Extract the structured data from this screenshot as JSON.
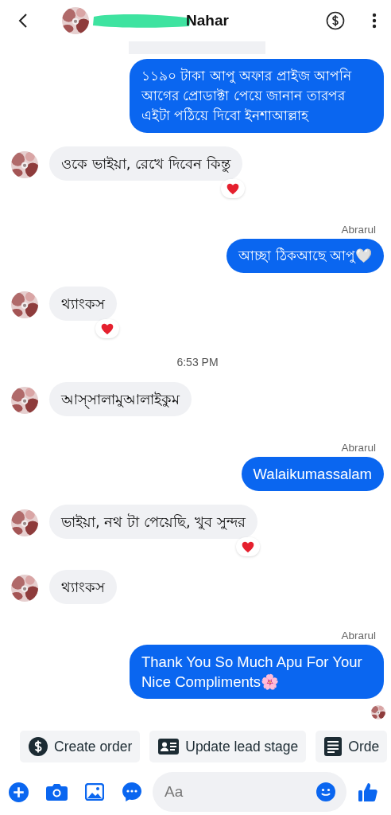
{
  "header": {
    "contact_name": "Nahar",
    "redacted": true
  },
  "messages": [
    {
      "kind": "partial"
    },
    {
      "kind": "outgoing",
      "text": "১১৯০ টাকা আপু অফার প্রাইজ আপনি আগের প্রোডাক্টা পেয়ে জানান তারপর এইটা পঠিয়ে দিবো ইনশাআল্লাহ"
    },
    {
      "kind": "incoming",
      "text": "ওকে ভাইয়া, রেখে দিবেন কিন্তু",
      "reacted": true
    },
    {
      "kind": "outgoing",
      "sender": "Abrarul",
      "text": "আচ্ছা ঠিকআছে আপু🤍"
    },
    {
      "kind": "incoming",
      "text": "থ্যাংকস",
      "reacted": true
    },
    {
      "kind": "time",
      "text": "6:53 PM"
    },
    {
      "kind": "incoming",
      "text": "আস্সালামুআলাইকুম",
      "reacted": false
    },
    {
      "kind": "outgoing",
      "sender": "Abrarul",
      "text": "Walaikumassalam"
    },
    {
      "kind": "incoming",
      "text": "ভাইয়া, নথ টা পেয়েছি, খুব সুন্দর",
      "reacted": true
    },
    {
      "kind": "incoming",
      "text": "থ্যাংকস",
      "reacted": false
    },
    {
      "kind": "outgoing",
      "sender": "Abrarul",
      "text": "Thank You So Much Apu For Your Nice Compliments🌸",
      "seen": true
    }
  ],
  "quick_actions": [
    {
      "kind": "dollar",
      "label": "Create order"
    },
    {
      "kind": "card",
      "label": "Update lead stage"
    },
    {
      "kind": "list",
      "label": "Orde"
    }
  ],
  "composer": {
    "placeholder": "Aa"
  }
}
